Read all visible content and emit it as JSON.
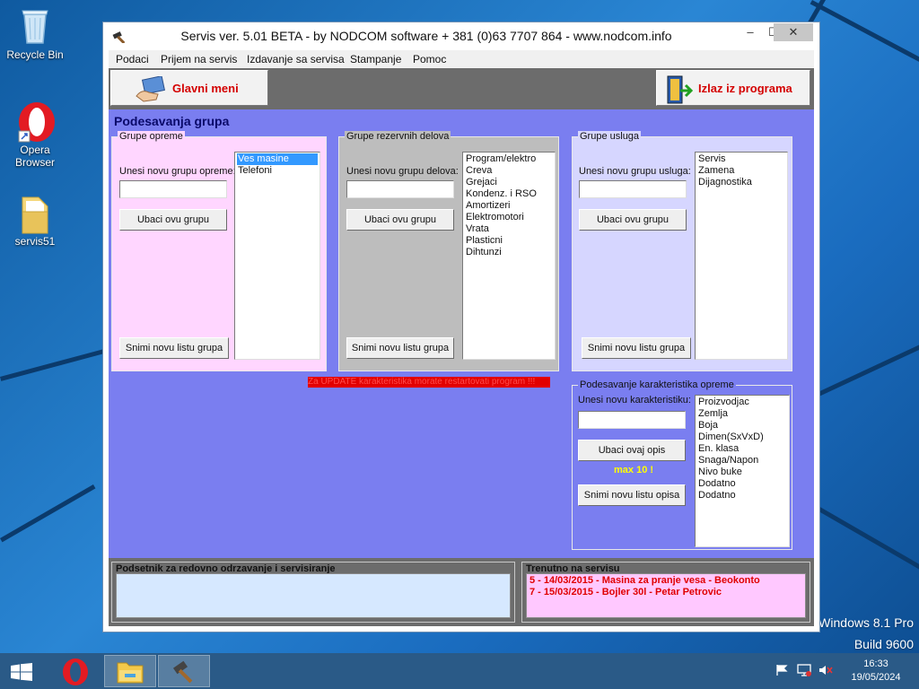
{
  "desktop": {
    "icons": [
      {
        "label": "Recycle Bin"
      },
      {
        "label": "Opera Browser"
      },
      {
        "label": "servis51"
      }
    ],
    "watermark": {
      "line1": "Windows 8.1 Pro",
      "line2": "Build 9600"
    }
  },
  "window": {
    "title": "Servis ver. 5.01 BETA - by NODCOM software  + 381 (0)63 7707 864 - www.nodcom.info",
    "controls": {
      "minimize": "–",
      "maximize": "☐",
      "close": "✕"
    },
    "menu": [
      "Podaci",
      "Prijem na servis",
      "Izdavanje sa servisa",
      "Stampanje",
      "Pomoc"
    ],
    "toolbar": {
      "main_menu": "Glavni meni",
      "exit": "Izlaz iz programa"
    },
    "section_title": "Podesavanja grupa",
    "equipment": {
      "legend": "Grupe opreme",
      "input_label": "Unesi novu grupu opreme:",
      "input_value": "",
      "add_button": "Ubaci ovu grupu",
      "save_button": "Snimi novu listu grupa",
      "items": [
        "Ves masine",
        "Telefoni"
      ],
      "selected_index": 0
    },
    "spare_parts": {
      "legend": "Grupe rezervnih delova",
      "input_label": "Unesi novu grupu delova:",
      "input_value": "",
      "add_button": "Ubaci ovu grupu",
      "save_button": "Snimi novu listu grupa",
      "items": [
        "Program/elektro",
        "Creva",
        "Grejaci",
        "Kondenz. i RSO",
        "Amortizeri",
        "Elektromotori",
        "Vrata",
        "Plasticni",
        "Dihtunzi"
      ]
    },
    "services": {
      "legend": "Grupe usluga",
      "input_label": "Unesi novu grupu usluga:",
      "input_value": "",
      "add_button": "Ubaci ovu grupu",
      "save_button": "Snimi novu listu grupa",
      "items": [
        "Servis",
        "Zamena",
        "Dijagnostika"
      ]
    },
    "warning": "Za UPDATE karakteristika morate restartovati program !!!",
    "characteristics": {
      "legend": "Podesavanje karakteristika opreme",
      "input_label": "Unesi novu karakteristiku:",
      "input_value": "",
      "add_button": "Ubaci ovaj opis",
      "max_note": "max 10 !",
      "save_button": "Snimi novu listu opisa",
      "items": [
        "Proizvodjac",
        "Zemlja",
        "Boja",
        "Dimen(SxVxD)",
        "En. klasa",
        "Snaga/Napon",
        "Nivo buke",
        "Dodatno",
        "Dodatno"
      ]
    },
    "reminder": {
      "title": "Podsetnik za redovno odrzavanje i servisiranje",
      "items": []
    },
    "current_service": {
      "title": "Trenutno na servisu",
      "items": [
        "5 - 14/03/2015 - Masina za pranje vesa - Beokonto",
        "7 - 15/03/2015 - Bojler 30l - Petar Petrovic"
      ]
    }
  },
  "taskbar": {
    "clock": {
      "time": "16:33",
      "date": "19/05/2024"
    }
  },
  "colors": {
    "content_bg": "#7a7ef0",
    "equipment_bg": "#ffd6ff",
    "spare_parts_bg": "#bdbdbd",
    "services_bg": "#d6d6ff",
    "reminder_bg": "#d6e8ff",
    "current_service_bg": "#ffc8ff",
    "warning_bg": "#e20000"
  }
}
